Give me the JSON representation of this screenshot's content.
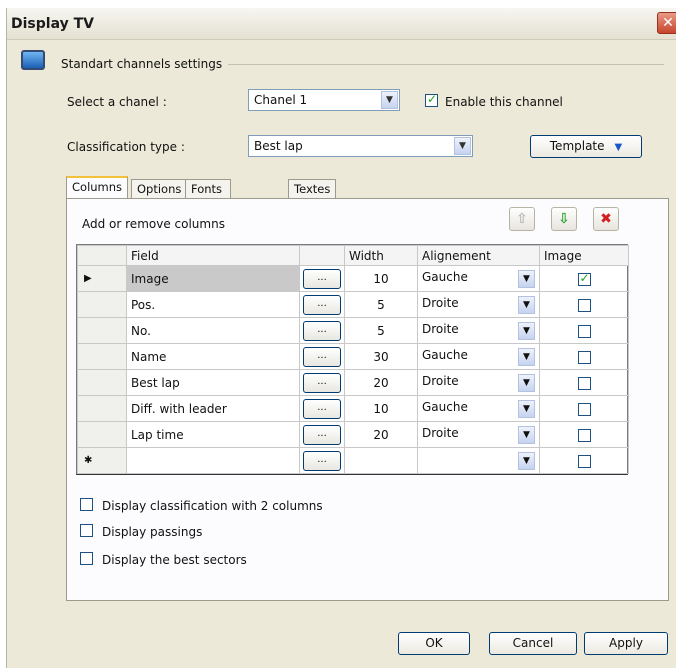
{
  "window": {
    "title": "Display TV",
    "close_glyph": "✕"
  },
  "group": {
    "title": "Standart channels settings"
  },
  "channel": {
    "label": "Select a chanel :",
    "value": "Chanel 1"
  },
  "enable": {
    "label": "Enable this channel",
    "checked": true
  },
  "classification": {
    "label": "Classification type :",
    "value": "Best lap"
  },
  "template_button": "Template",
  "tabs": [
    "Columns",
    "Options",
    "Fonts and colors",
    "Textes"
  ],
  "columns_panel": {
    "title": "Add or remove columns"
  },
  "toolbar": {
    "up": "⇧",
    "down": "⇩",
    "delete": "✖"
  },
  "grid": {
    "headers": {
      "field": "Field",
      "button": "",
      "width": "Width",
      "alignment": "Alignement",
      "image": "Image"
    },
    "dots_label": "...",
    "rows": [
      {
        "marker": "▶",
        "field": "Image",
        "width": "10",
        "align": "Gauche",
        "image": true
      },
      {
        "marker": "",
        "field": "Pos.",
        "width": "5",
        "align": "Droite",
        "image": false
      },
      {
        "marker": "",
        "field": "No.",
        "width": "5",
        "align": "Droite",
        "image": false
      },
      {
        "marker": "",
        "field": "Name",
        "width": "30",
        "align": "Gauche",
        "image": false
      },
      {
        "marker": "",
        "field": "Best lap",
        "width": "20",
        "align": "Droite",
        "image": false
      },
      {
        "marker": "",
        "field": "Diff. with leader",
        "width": "10",
        "align": "Gauche",
        "image": false
      },
      {
        "marker": "",
        "field": "Lap time",
        "width": "20",
        "align": "Droite",
        "image": false
      },
      {
        "marker": "✱",
        "field": "",
        "width": "",
        "align": "",
        "image": false
      }
    ]
  },
  "options": [
    {
      "label": "Display classification with 2 columns",
      "checked": false
    },
    {
      "label": "Display passings",
      "checked": false
    },
    {
      "label": "Display the best sectors",
      "checked": false
    }
  ],
  "buttons": {
    "ok": "OK",
    "cancel": "Cancel",
    "apply": "Apply"
  },
  "colors": {
    "accent": "#003c74",
    "check": "#21a121",
    "close": "#c8452d"
  }
}
